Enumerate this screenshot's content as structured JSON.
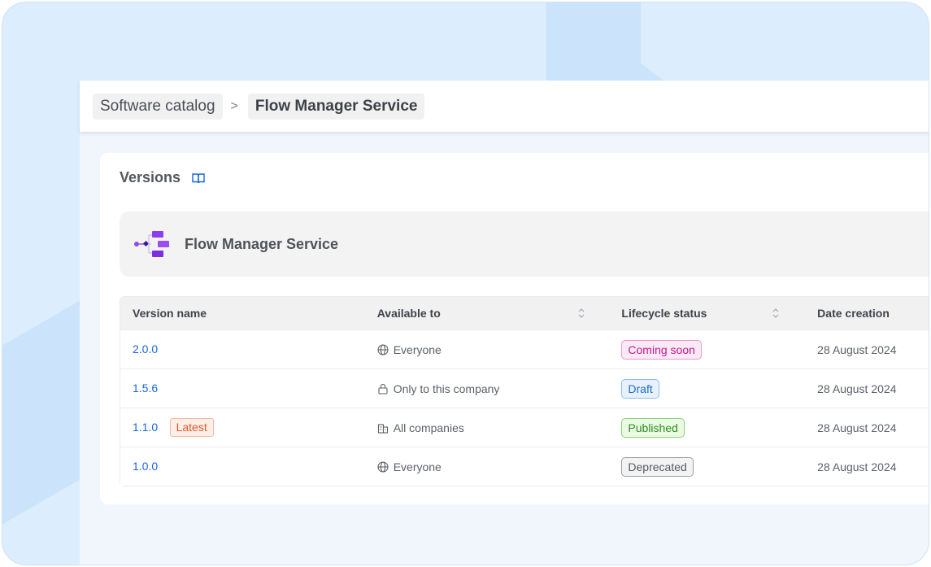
{
  "breadcrumb": {
    "root": "Software catalog",
    "separator": ">",
    "current": "Flow Manager Service"
  },
  "versions_card": {
    "title": "Versions",
    "docs_icon": "book-icon"
  },
  "service": {
    "name": "Flow Manager Service",
    "icon": "flow-diagram-icon"
  },
  "table": {
    "headers": {
      "version_name": "Version name",
      "available_to": "Available to",
      "lifecycle_status": "Lifecycle status",
      "date_creation": "Date creation"
    },
    "rows": [
      {
        "version": "2.0.0",
        "badge": "",
        "availability": "Everyone",
        "availability_icon": "globe-icon",
        "status": "Coming soon",
        "status_colors": {
          "text": "#c2188c",
          "bg": "#fbe9f6",
          "border": "#e79ad1"
        },
        "date": "28 August 2024"
      },
      {
        "version": "1.5.6",
        "badge": "",
        "availability": "Only to this company",
        "availability_icon": "lock-icon",
        "status": "Draft",
        "status_colors": {
          "text": "#1e6bc6",
          "bg": "#e6f1fd",
          "border": "#8fbcec"
        },
        "date": "28 August 2024"
      },
      {
        "version": "1.1.0",
        "badge": "Latest",
        "availability": "All companies",
        "availability_icon": "buildings-icon",
        "status": "Published",
        "status_colors": {
          "text": "#2e8b1e",
          "bg": "#eafbe4",
          "border": "#86d472"
        },
        "date": "28 August 2024"
      },
      {
        "version": "1.0.0",
        "badge": "",
        "availability": "Everyone",
        "availability_icon": "globe-icon",
        "status": "Deprecated",
        "status_colors": {
          "text": "#555a62",
          "bg": "#f3f3f4",
          "border": "#9a9ea5"
        },
        "date": "28 August 2024"
      }
    ]
  },
  "colors": {
    "link": "#1967d2",
    "accent_purple": "#7b2fd8",
    "frame_bg": "#dcedfd"
  }
}
